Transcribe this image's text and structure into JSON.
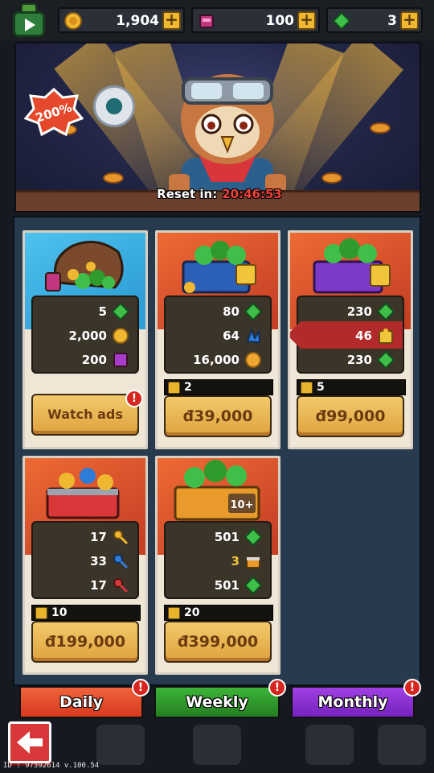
{
  "currencies": {
    "coins": "1,904",
    "tickets": "100",
    "gems": "3"
  },
  "banner": {
    "badge": "200%",
    "reset_label": "Reset in:",
    "reset_timer": "20:46:53"
  },
  "offers": [
    {
      "rewards": [
        "5",
        "2,000",
        "200"
      ],
      "button": "Watch ads"
    },
    {
      "rewards": [
        "80",
        "64",
        "16,000"
      ],
      "count": "2",
      "button": "đ39,000"
    },
    {
      "rewards": [
        "230",
        "46",
        "230"
      ],
      "count": "5",
      "button": "đ99,000"
    },
    {
      "rewards": [
        "17",
        "33",
        "17"
      ],
      "count": "10",
      "button": "đ199,000"
    },
    {
      "rewards": [
        "501",
        "3",
        "501"
      ],
      "count": "20",
      "button": "đ399,000"
    }
  ],
  "tabs": {
    "daily": "Daily",
    "weekly": "Weekly",
    "monthly": "Monthly",
    "alert": "!"
  },
  "footer": {
    "build": "ID : 97592614 v.100.54"
  },
  "colors": {
    "gem": "#3fbf4a",
    "coin": "#f0a531",
    "daily": "#e5482a",
    "weekly": "#2f9b2c",
    "monthly": "#8b2fd0"
  }
}
